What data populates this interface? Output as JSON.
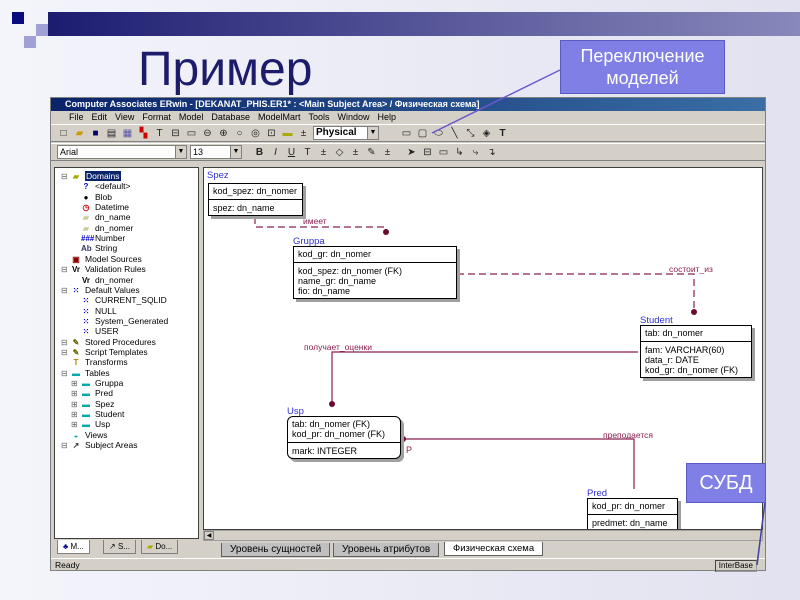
{
  "slide": {
    "title": "Пример",
    "callout_model_switch": "Переключение моделей",
    "callout_dbms": "СУБД",
    "colors": {
      "title": "#1c1c6a",
      "callout": "#7f7fe6",
      "relationship": "#8a2050",
      "entity_name": "#3030d0"
    }
  },
  "window": {
    "title": "Computer Associates ERwin - [DEKANAT_PHIS.ER1* : <Main Subject Area> / Физическая схема]",
    "menu": [
      "File",
      "Edit",
      "View",
      "Format",
      "Model",
      "Database",
      "ModelMart",
      "Tools",
      "Window",
      "Help"
    ],
    "model_select": "Physical",
    "font_select": "Arial",
    "size_select": "13",
    "status_left": "Ready",
    "status_right": "InterBase"
  },
  "tree": [
    {
      "label": "Domains",
      "icon": "domain-folder-icon",
      "level": 0,
      "selected": true
    },
    {
      "label": "<default>",
      "icon": "question-icon",
      "level": 1
    },
    {
      "label": "Blob",
      "icon": "blob-icon",
      "level": 1
    },
    {
      "label": "Datetime",
      "icon": "clock-icon",
      "level": 1
    },
    {
      "label": "dn_name",
      "icon": "folder-icon",
      "level": 1
    },
    {
      "label": "dn_nomer",
      "icon": "folder-icon",
      "level": 1
    },
    {
      "label": "Number",
      "icon": "number-icon",
      "level": 1
    },
    {
      "label": "String",
      "icon": "string-icon",
      "level": 1
    },
    {
      "label": "Model Sources",
      "icon": "model-source-icon",
      "level": 0
    },
    {
      "label": "Validation Rules",
      "icon": "validation-icon",
      "level": 0
    },
    {
      "label": "dn_nomer",
      "icon": "validation-icon",
      "level": 1
    },
    {
      "label": "Default Values",
      "icon": "default-value-icon",
      "level": 0
    },
    {
      "label": "CURRENT_SQLID",
      "icon": "default-value-icon",
      "level": 1
    },
    {
      "label": "NULL",
      "icon": "default-value-icon",
      "level": 1
    },
    {
      "label": "System_Generated",
      "icon": "default-value-icon",
      "level": 1
    },
    {
      "label": "USER",
      "icon": "default-value-icon",
      "level": 1
    },
    {
      "label": "Stored Procedures",
      "icon": "procedure-icon",
      "level": 0
    },
    {
      "label": "Script Templates",
      "icon": "script-icon",
      "level": 0
    },
    {
      "label": "Transforms",
      "icon": "transform-icon",
      "level": 0
    },
    {
      "label": "Tables",
      "icon": "tables-icon",
      "level": 0
    },
    {
      "label": "Gruppa",
      "icon": "table-icon",
      "level": 1
    },
    {
      "label": "Pred",
      "icon": "table-icon",
      "level": 1
    },
    {
      "label": "Spez",
      "icon": "table-icon",
      "level": 1
    },
    {
      "label": "Student",
      "icon": "table-icon",
      "level": 1
    },
    {
      "label": "Usp",
      "icon": "table-icon",
      "level": 1
    },
    {
      "label": "Views",
      "icon": "views-icon",
      "level": 0
    },
    {
      "label": "Subject Areas",
      "icon": "subject-area-icon",
      "level": 0
    }
  ],
  "left_tabs": [
    "M...",
    "S...",
    "Do..."
  ],
  "entities": {
    "spez": {
      "name": "Spez",
      "pk": [
        "kod_spez: dn_nomer"
      ],
      "attrs": [
        "spez: dn_name"
      ]
    },
    "gruppa": {
      "name": "Gruppa",
      "pk": [
        "kod_gr: dn_nomer"
      ],
      "attrs": [
        "kod_spez: dn_nomer (FK)",
        "name_gr: dn_name",
        "fio: dn_name"
      ]
    },
    "student": {
      "name": "Student",
      "pk": [
        "tab: dn_nomer"
      ],
      "attrs": [
        "fam: VARCHAR(60)",
        "data_r: DATE",
        "kod_gr: dn_nomer (FK)"
      ]
    },
    "usp": {
      "name": "Usp",
      "pk": [
        "tab: dn_nomer (FK)",
        "kod_pr: dn_nomer (FK)"
      ],
      "attrs": [
        "mark: INTEGER"
      ]
    },
    "pred": {
      "name": "Pred",
      "pk": [
        "kod_pr: dn_nomer"
      ],
      "attrs": [
        "predmet: dn_name"
      ]
    }
  },
  "relationships": {
    "r1": "имеет",
    "r2": "состоит_из",
    "r3": "получает_оценки",
    "r4": "преподается",
    "p_marker": "P"
  },
  "model_tabs": [
    "Уровень сущностей",
    "Уровень атрибутов",
    "Физическая схема"
  ]
}
